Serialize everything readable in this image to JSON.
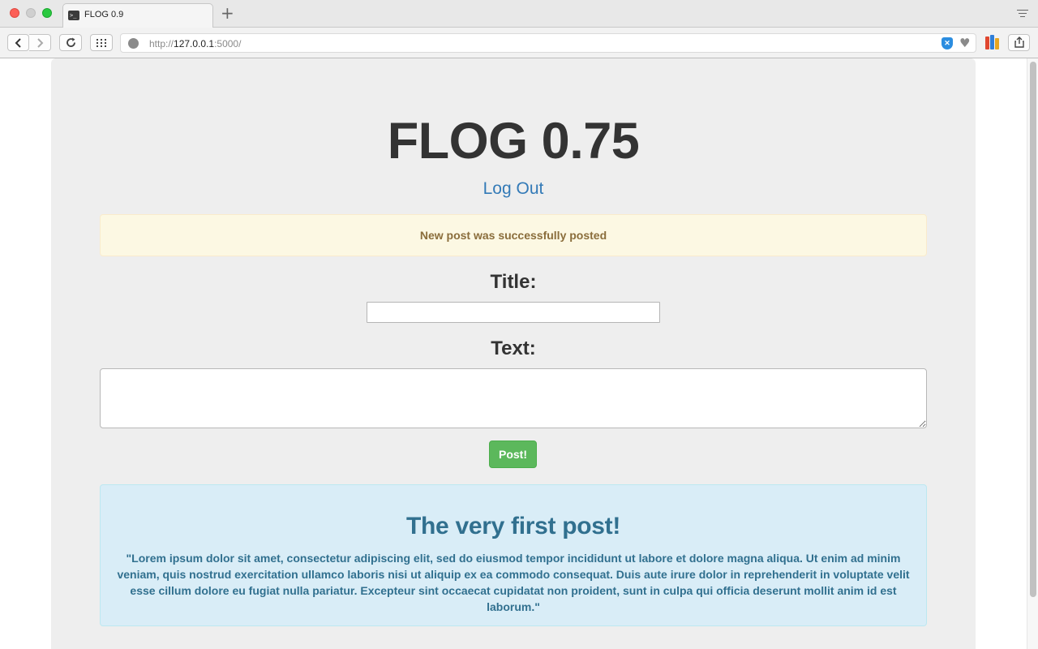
{
  "browser": {
    "tab_title": "FLOG 0.9",
    "new_tab_symbol": "+",
    "url_scheme": "http://",
    "url_host": "127.0.0.1",
    "url_rest": ":5000/",
    "icons": [
      "back-icon",
      "forward-icon",
      "reload-icon",
      "grid-icon",
      "globe-icon",
      "shield-icon",
      "heart-icon",
      "books-icon",
      "share-icon"
    ]
  },
  "page": {
    "site_title": "FLOG 0.75",
    "logout_label": "Log Out",
    "flash_message": "New post was successfully posted",
    "title_label": "Title:",
    "title_value": "",
    "text_label": "Text:",
    "text_value": "",
    "post_button": "Post!",
    "posts": [
      {
        "title": "The very first post!",
        "body": "\"Lorem ipsum dolor sit amet, consectetur adipiscing elit, sed do eiusmod tempor incididunt ut labore et dolore magna aliqua. Ut enim ad minim veniam, quis nostrud exercitation ullamco laboris nisi ut aliquip ex ea commodo consequat. Duis aute irure dolor in reprehenderit in voluptate velit esse cillum dolore eu fugiat nulla pariatur. Excepteur sint occaecat cupidatat non proident, sunt in culpa qui officia deserunt mollit anim id est laborum.\""
      }
    ]
  },
  "colors": {
    "jumbotron_bg": "#eeeeee",
    "link": "#337ab7",
    "warning_bg": "#fcf8e3",
    "warning_text": "#8a6d3b",
    "info_bg": "#d9edf7",
    "info_text": "#31708f",
    "success_button": "#5cb85c"
  }
}
